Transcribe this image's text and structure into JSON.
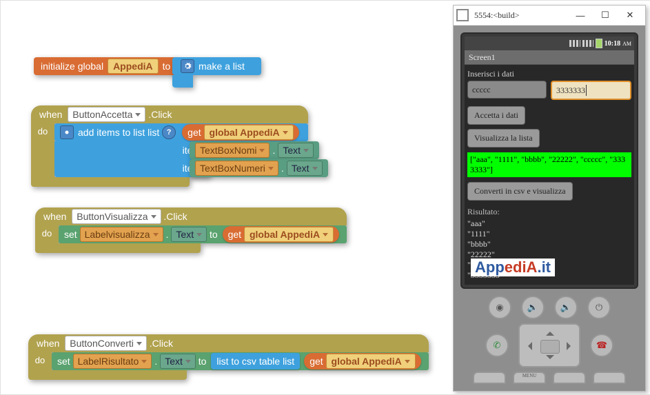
{
  "blocks": {
    "init": {
      "prefix": "initialize global",
      "varname": "AppediA",
      "to": "to",
      "make_list": "make a list"
    },
    "accetta": {
      "when": "when",
      "component": "ButtonAccetta",
      "event": ".Click",
      "do": "do",
      "additems": "add items to list  list",
      "item": "item",
      "get": "get",
      "globalvar": "global AppediA",
      "tb1": "TextBoxNomi",
      "tb2": "TextBoxNumeri",
      "text": "Text"
    },
    "visual": {
      "when": "when",
      "component": "ButtonVisualizza",
      "event": ".Click",
      "do": "do",
      "set": "set",
      "target": "Labelvisualizza",
      "text": "Text",
      "to": "to",
      "get": "get",
      "globalvar": "global AppediA"
    },
    "conv": {
      "when": "when",
      "component": "ButtonConverti",
      "event": ".Click",
      "do": "do",
      "set": "set",
      "target": "LabelRisultato",
      "text": "Text",
      "to": "to",
      "csv": "list to csv table  list",
      "get": "get",
      "globalvar": "global AppediA"
    }
  },
  "emulator": {
    "window_title": "5554:<build>",
    "time": "10:18",
    "ampm": "AM",
    "screen_title": "Screen1",
    "prompt": "Inserisci i dati",
    "input1_value": "ccccc",
    "input2_value": "3333333",
    "btn_accetta": "Accetta i dati",
    "btn_visualizza": "Visualizza la lista",
    "debug_output": "[\"aaa\", \"1111\", \"bbbb\", \"22222\", \"ccccc\", \"3333333\"]",
    "btn_converti": "Converti in csv e visualizza",
    "result_label": "Risultato:",
    "result_text": "\"aaa\"\n\"1111\"\n\"bbbb\"\n\"22222\"\n\"ccccc\"\n\"3333333\"",
    "menu_label": "MENU"
  },
  "watermark": {
    "a": "App",
    "b": "ediA",
    "c": ".it"
  }
}
